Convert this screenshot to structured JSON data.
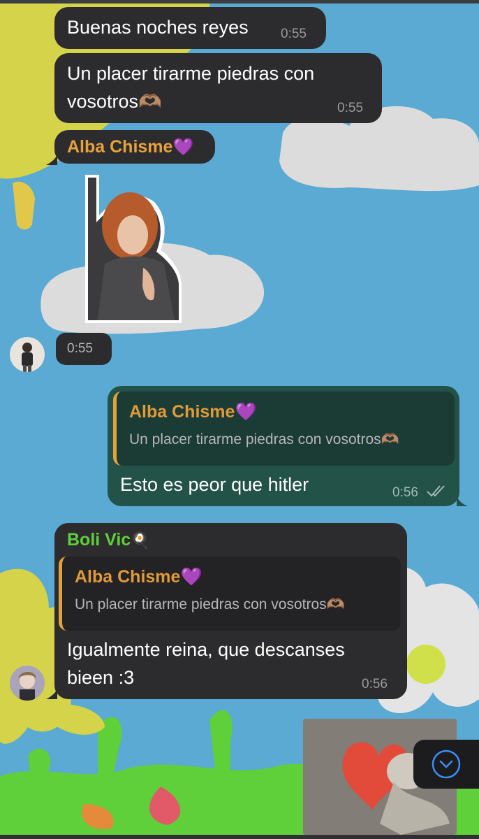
{
  "messages": {
    "m1": {
      "text": "Buenas noches reyes",
      "time": "0:55"
    },
    "m2": {
      "text_line1": "Un placer tirarme piedras con",
      "text_line2": "vosotros",
      "emoji": "🫶🏽",
      "time": "0:55"
    },
    "m3": {
      "sender": "Alba Chisme",
      "sender_emoji": "💜",
      "time": "0:55"
    },
    "m4": {
      "reply_name": "Alba Chisme",
      "reply_emoji": "💜",
      "reply_text": "Un placer tirarme piedras con vosotros",
      "reply_text_emoji": "🫶🏽",
      "text": "Esto es peor que hitler",
      "time": "0:56",
      "status": "✓✓"
    },
    "m5": {
      "sender": "Boli Vic",
      "sender_emoji": "🍳",
      "reply_name": "Alba Chisme",
      "reply_emoji": "💜",
      "reply_text": "Un placer tirarme piedras con vosotros",
      "reply_text_emoji": "🫶🏽",
      "text_line1": "Igualmente reina, que descanses",
      "text_line2": "bieen :3",
      "time": "0:56"
    }
  },
  "colors": {
    "incoming_bubble": "#2c2c2e",
    "outgoing_bubble": "#235249",
    "sender_alba": "#e8a23c",
    "sender_boli": "#5fcf3a",
    "accent_blue": "#3a8ff7"
  },
  "icons": {
    "scroll_down": "chevron-down-circle-icon",
    "read_receipt": "double-check-icon"
  }
}
